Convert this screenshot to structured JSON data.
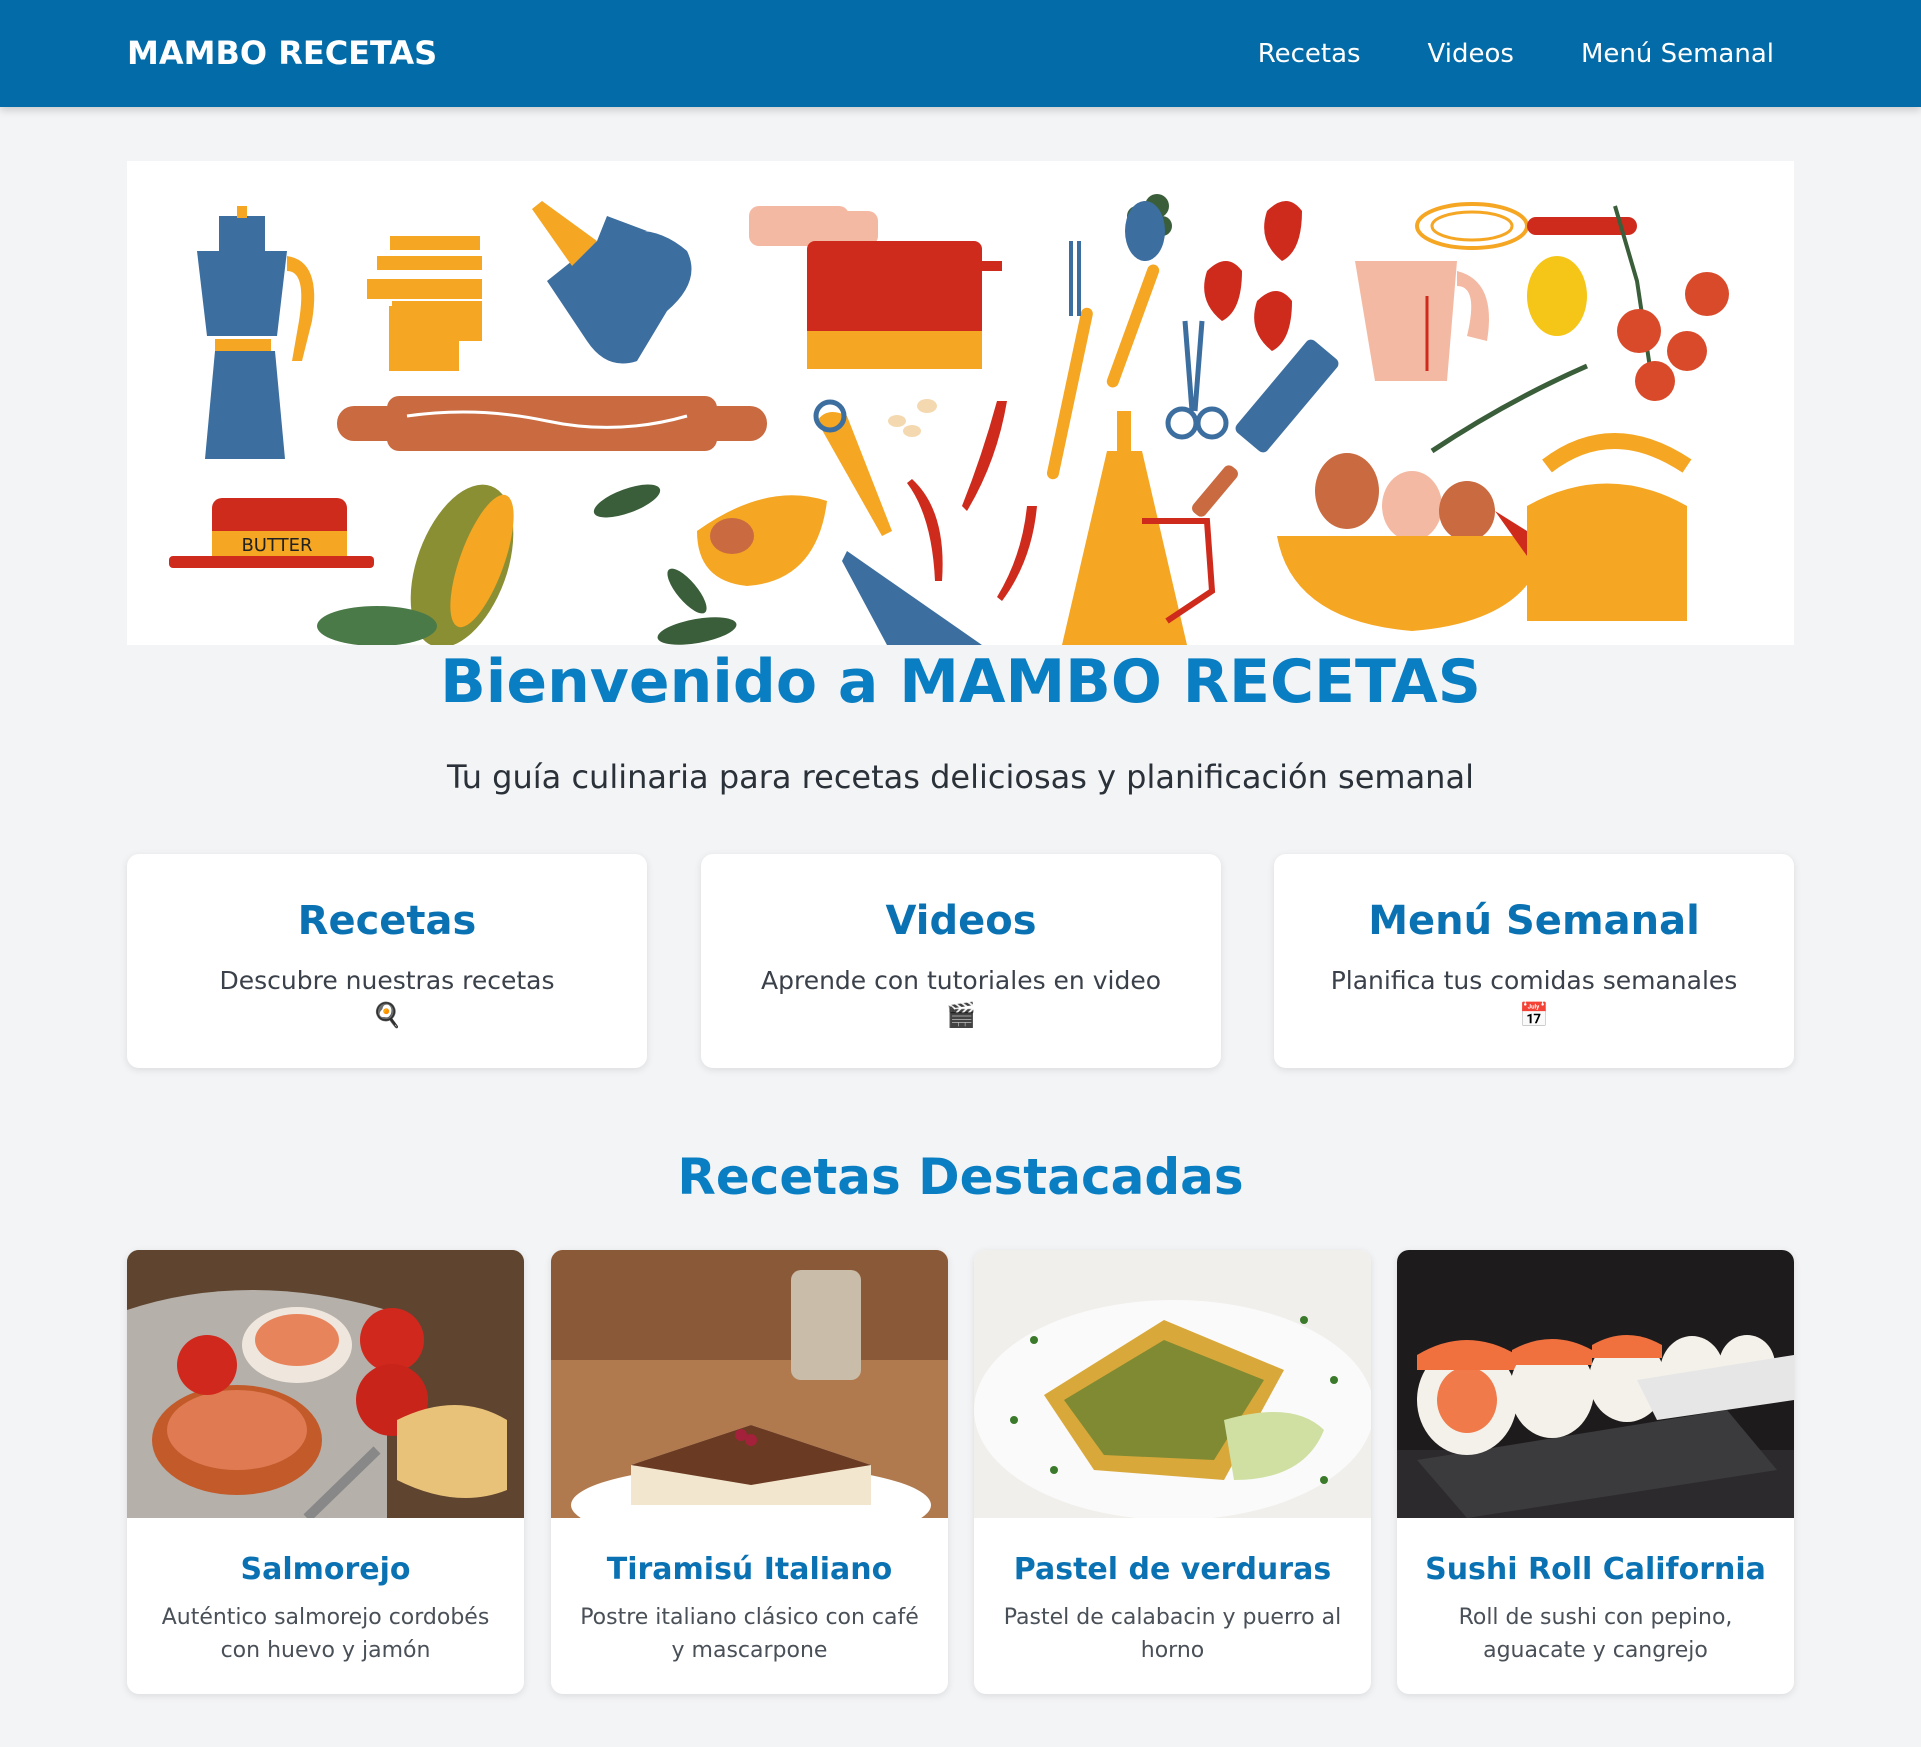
{
  "header": {
    "brand": "MAMBO RECETAS",
    "nav": [
      "Recetas",
      "Videos",
      "Menú Semanal"
    ]
  },
  "hero": {
    "butter_label": "BUTTER"
  },
  "welcome": {
    "title": "Bienvenido a MAMBO RECETAS",
    "tagline": "Tu guía culinaria para recetas deliciosas y planificación semanal"
  },
  "features": [
    {
      "title": "Recetas",
      "description": "Descubre nuestras recetas",
      "icon": "🍳",
      "icon_name": "cooking-icon"
    },
    {
      "title": "Videos",
      "description": "Aprende con tutoriales en video",
      "icon": "🎬",
      "icon_name": "clapper-icon"
    },
    {
      "title": "Menú Semanal",
      "description": "Planifica tus comidas semanales",
      "icon": "📅",
      "icon_name": "calendar-icon"
    }
  ],
  "featured": {
    "title": "Recetas Destacadas",
    "recipes": [
      {
        "title": "Salmorejo",
        "description": "Auténtico salmorejo cordobés con huevo y jamón"
      },
      {
        "title": "Tiramisú Italiano",
        "description": "Postre italiano clásico con café y mascarpone"
      },
      {
        "title": "Pastel de verduras",
        "description": "Pastel de calabacin y puerro al horno"
      },
      {
        "title": "Sushi Roll California",
        "description": "Roll de sushi con pepino, aguacate y cangrejo"
      }
    ]
  },
  "colors": {
    "header_bg": "#036ba7",
    "accent": "#0a7ec2",
    "page_bg": "#f3f4f6"
  }
}
